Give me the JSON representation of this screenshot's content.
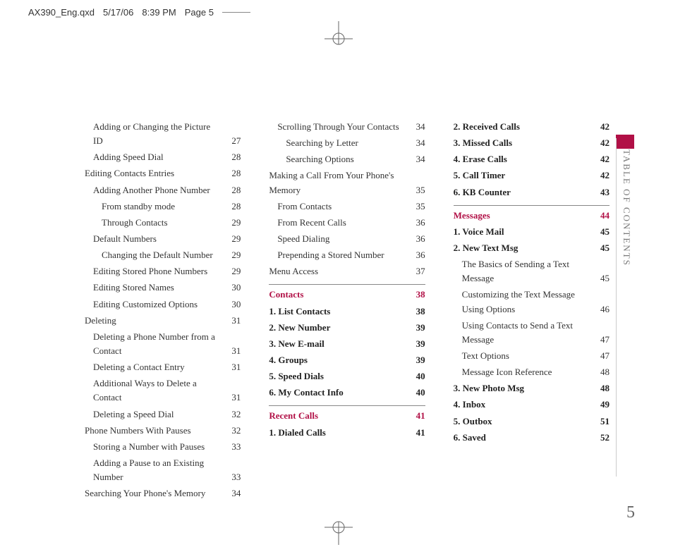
{
  "header": {
    "file": "AX390_Eng.qxd",
    "date": "5/17/06",
    "time": "8:39 PM",
    "page": "Page 5"
  },
  "sideLabel": "TABLE OF CONTENTS",
  "pageNumber": "5",
  "col1": [
    {
      "label": "Adding or Changing the Picture ID",
      "pg": "27",
      "cls": "ind1"
    },
    {
      "label": "Adding Speed Dial",
      "pg": "28",
      "cls": "ind1"
    },
    {
      "label": "Editing Contacts Entries",
      "pg": "28",
      "cls": ""
    },
    {
      "label": "Adding Another Phone Number",
      "pg": "28",
      "cls": "ind1"
    },
    {
      "label": "From standby mode",
      "pg": "28",
      "cls": "ind2"
    },
    {
      "label": "Through Contacts",
      "pg": "29",
      "cls": "ind2"
    },
    {
      "label": "Default Numbers",
      "pg": "29",
      "cls": "ind1"
    },
    {
      "label": "Changing the Default Number",
      "pg": "29",
      "cls": "ind2"
    },
    {
      "label": "Editing Stored Phone Numbers",
      "pg": "29",
      "cls": "ind1"
    },
    {
      "label": "Editing Stored Names",
      "pg": "30",
      "cls": "ind1"
    },
    {
      "label": "Editing Customized Options",
      "pg": "30",
      "cls": "ind1"
    },
    {
      "label": "Deleting",
      "pg": "31",
      "cls": ""
    },
    {
      "label": "Deleting a Phone Number from a Contact",
      "pg": "31",
      "cls": "ind1"
    },
    {
      "label": "Deleting a Contact Entry",
      "pg": "31",
      "cls": "ind1"
    },
    {
      "label": "Additional Ways to Delete a Contact",
      "pg": "31",
      "cls": "ind1"
    },
    {
      "label": "Deleting a Speed Dial",
      "pg": "32",
      "cls": "ind1"
    },
    {
      "label": "Phone Numbers With Pauses",
      "pg": "32",
      "cls": ""
    },
    {
      "label": "Storing a Number with Pauses",
      "pg": "33",
      "cls": "ind1"
    },
    {
      "label": "Adding a Pause to an Existing Number",
      "pg": "33",
      "cls": "ind1"
    },
    {
      "label": "Searching Your Phone's Memory",
      "pg": "34",
      "cls": ""
    }
  ],
  "col2": [
    {
      "label": "Scrolling Through Your Contacts",
      "pg": "34",
      "cls": "ind1"
    },
    {
      "label": "Searching by Letter",
      "pg": "34",
      "cls": "ind2"
    },
    {
      "label": "Searching Options",
      "pg": "34",
      "cls": "ind2"
    },
    {
      "label": "Making a Call From Your Phone's Memory",
      "pg": "35",
      "cls": ""
    },
    {
      "label": "From Contacts",
      "pg": "35",
      "cls": "ind1"
    },
    {
      "label": "From Recent Calls",
      "pg": "36",
      "cls": "ind1"
    },
    {
      "label": "Speed Dialing",
      "pg": "36",
      "cls": "ind1"
    },
    {
      "label": "Prepending a Stored Number",
      "pg": "36",
      "cls": "ind1"
    },
    {
      "label": "Menu Access",
      "pg": "37",
      "cls": ""
    },
    {
      "label": "Contacts",
      "pg": "38",
      "cls": "section"
    },
    {
      "label": "1. List Contacts",
      "pg": "38",
      "cls": "bold"
    },
    {
      "label": "2. New Number",
      "pg": "39",
      "cls": "bold"
    },
    {
      "label": "3. New E-mail",
      "pg": "39",
      "cls": "bold"
    },
    {
      "label": "4. Groups",
      "pg": "39",
      "cls": "bold"
    },
    {
      "label": "5. Speed Dials",
      "pg": "40",
      "cls": "bold"
    },
    {
      "label": "6. My Contact Info",
      "pg": "40",
      "cls": "bold"
    },
    {
      "label": "Recent Calls",
      "pg": "41",
      "cls": "section"
    },
    {
      "label": "1. Dialed Calls",
      "pg": "41",
      "cls": "bold"
    }
  ],
  "col3": [
    {
      "label": "2. Received Calls",
      "pg": "42",
      "cls": "bold"
    },
    {
      "label": "3. Missed Calls",
      "pg": "42",
      "cls": "bold"
    },
    {
      "label": "4. Erase Calls",
      "pg": "42",
      "cls": "bold"
    },
    {
      "label": "5. Call Timer",
      "pg": "42",
      "cls": "bold"
    },
    {
      "label": "6. KB Counter",
      "pg": "43",
      "cls": "bold"
    },
    {
      "label": "Messages",
      "pg": "44",
      "cls": "section"
    },
    {
      "label": "1. Voice Mail",
      "pg": "45",
      "cls": "bold"
    },
    {
      "label": "2. New Text Msg",
      "pg": "45",
      "cls": "bold"
    },
    {
      "label": "The Basics of Sending a Text Message",
      "pg": "45",
      "cls": "ind1"
    },
    {
      "label": "Customizing the Text Message Using Options",
      "pg": "46",
      "cls": "ind1"
    },
    {
      "label": "Using Contacts to Send a Text Message",
      "pg": "47",
      "cls": "ind1"
    },
    {
      "label": "Text Options",
      "pg": "47",
      "cls": "ind1"
    },
    {
      "label": "Message Icon Reference",
      "pg": "48",
      "cls": "ind1"
    },
    {
      "label": "3. New Photo Msg",
      "pg": "48",
      "cls": "bold"
    },
    {
      "label": "4. Inbox",
      "pg": "49",
      "cls": "bold"
    },
    {
      "label": "5. Outbox",
      "pg": "51",
      "cls": "bold"
    },
    {
      "label": "6. Saved",
      "pg": "52",
      "cls": "bold"
    }
  ]
}
